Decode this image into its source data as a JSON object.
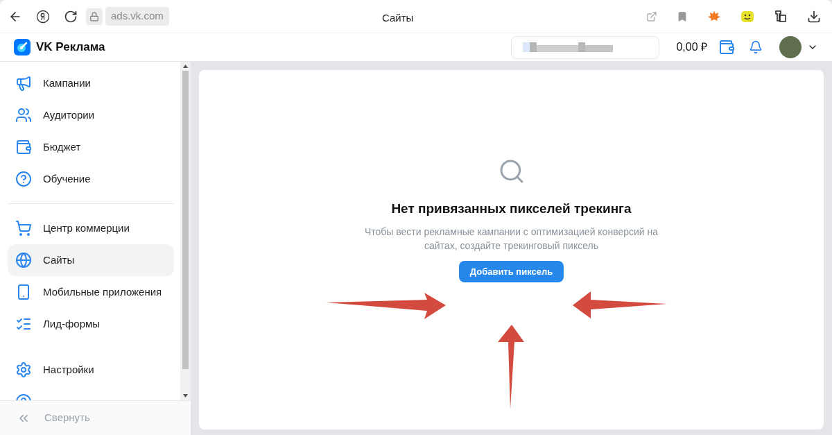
{
  "browser": {
    "address": "ads.vk.com",
    "tab_title": "Сайты"
  },
  "header": {
    "logo": "VK Реклама",
    "balance": "0,00 ₽"
  },
  "sidebar": {
    "groups": [
      [
        {
          "label": "Кампании",
          "selected": false
        },
        {
          "label": "Аудитории",
          "selected": false
        },
        {
          "label": "Бюджет",
          "selected": false
        },
        {
          "label": "Обучение",
          "selected": false
        }
      ],
      [
        {
          "label": "Центр коммерции",
          "selected": false
        },
        {
          "label": "Сайты",
          "selected": true
        },
        {
          "label": "Мобильные приложения",
          "selected": false
        },
        {
          "label": "Лид-формы",
          "selected": false
        }
      ],
      [
        {
          "label": "Настройки",
          "selected": false
        }
      ]
    ],
    "collapse": "Свернуть"
  },
  "empty_state": {
    "title": "Нет привязанных пикселей трекинга",
    "description": "Чтобы вести рекламные кампании с оптимизацией конверсий на сайтах, создайте трекинговый пиксель",
    "button": "Добавить пиксель"
  }
}
